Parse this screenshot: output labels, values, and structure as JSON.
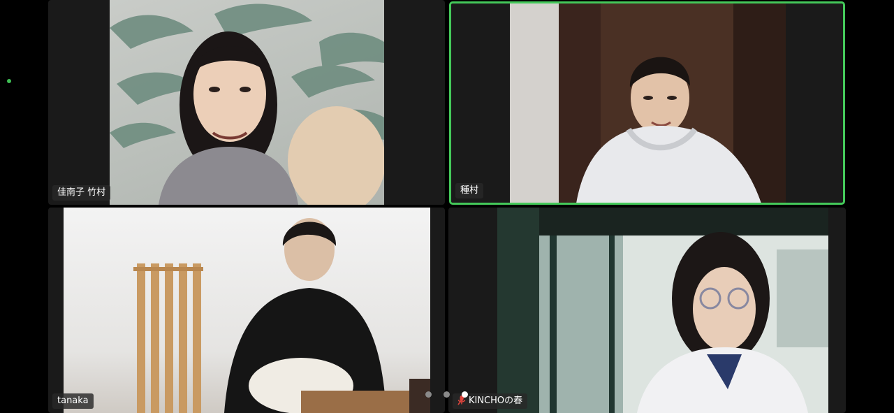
{
  "participants": [
    {
      "name": "佳南子 竹村",
      "active_speaker": false,
      "muted": false
    },
    {
      "name": "種村",
      "active_speaker": true,
      "muted": false
    },
    {
      "name": "tanaka",
      "active_speaker": false,
      "muted": false
    },
    {
      "name": "KINCHOの春",
      "active_speaker": false,
      "muted": true
    }
  ],
  "pagination": {
    "page_count": 3,
    "current_page": 3
  },
  "colors": {
    "active_speaker_border": "#44c95a",
    "muted_icon": "#e0443c",
    "background": "#000000"
  },
  "icons": {
    "muted": "microphone-muted-icon"
  }
}
